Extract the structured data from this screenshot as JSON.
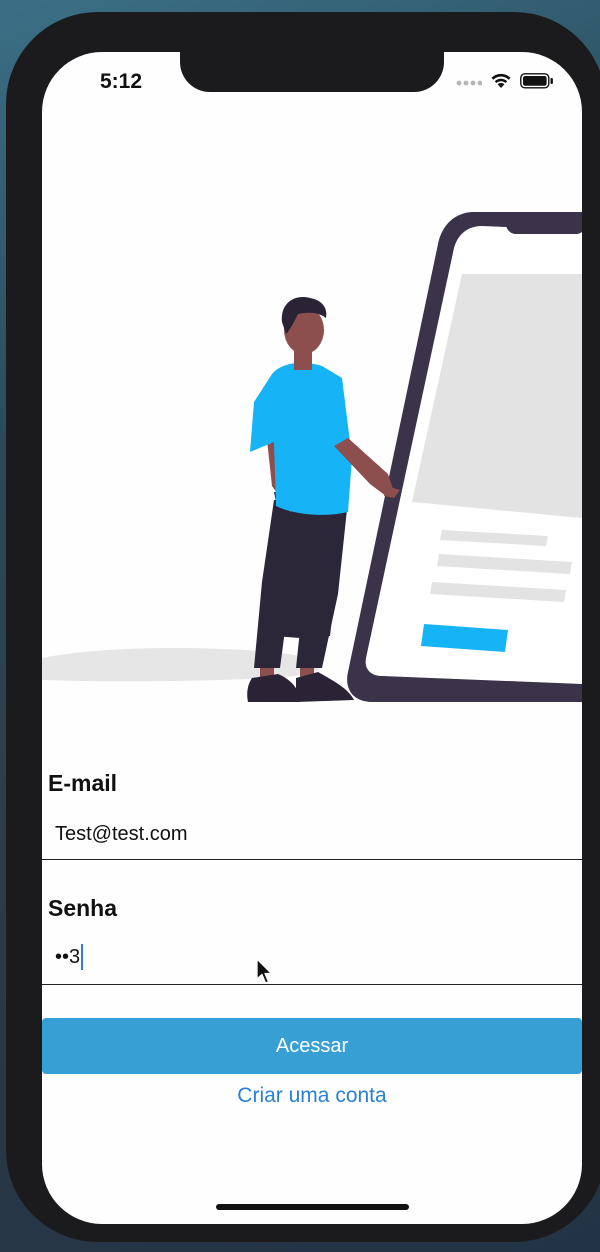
{
  "status_bar": {
    "time": "5:12",
    "icons": [
      "signal-dots-icon",
      "wifi-icon",
      "battery-icon"
    ]
  },
  "illustration": {
    "description_name": "person-with-phone-illustration",
    "colors": {
      "shirt": "#16b4f7",
      "skin": "#8d4f4e",
      "hair": "#2a2235",
      "pants": "#2b2738",
      "phone_frame": "#3a3349",
      "screen_block": "#e3e3e3",
      "accent_bar": "#16b4f7",
      "shadow": "#e6e6e6"
    }
  },
  "form": {
    "email": {
      "label": "E-mail",
      "value": "Test@test.com"
    },
    "password": {
      "label": "Senha",
      "masked_value": "••3"
    }
  },
  "actions": {
    "submit_label": "Acessar",
    "create_account_label": "Criar uma conta"
  },
  "colors": {
    "primary_button": "#389fd5",
    "link": "#2a7fd6",
    "caret": "#2f7bd8"
  }
}
